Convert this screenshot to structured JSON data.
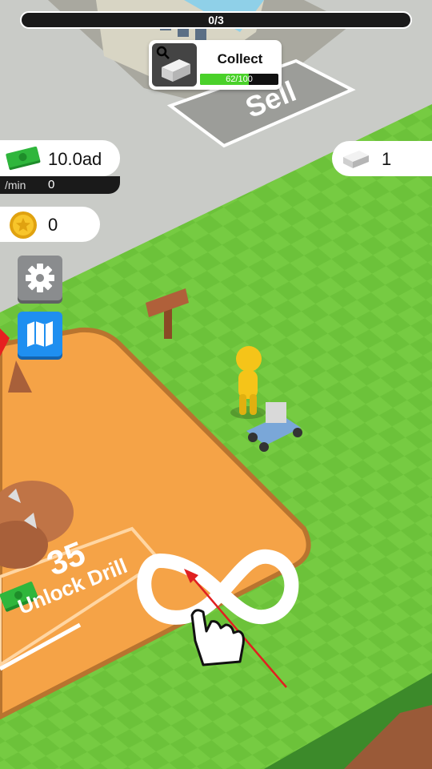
{
  "top_progress": {
    "text": "0/3",
    "fraction": 0
  },
  "collect_card": {
    "title": "Collect",
    "progress_label": "62/100",
    "progress": 0.62
  },
  "sell_zone": {
    "label": "Sell"
  },
  "currency": {
    "money_value": "10.0ad",
    "per_min_label": "/min",
    "per_min_value": "0",
    "coin_value": "0",
    "brick_value": "1"
  },
  "unlock_zone": {
    "price": "35",
    "label": "Unlock Drill"
  },
  "icons": [
    "magnifier-icon",
    "cash-icon",
    "coin-icon",
    "brick-icon",
    "gear-icon",
    "map-icon",
    "infinity-gesture-icon",
    "hand-pointer-icon",
    "arrow-icon"
  ],
  "colors": {
    "grass": "#6cc23a",
    "sand": "#f5a347",
    "progress_green": "#4ad12a",
    "map_blue": "#1f8ff0"
  }
}
